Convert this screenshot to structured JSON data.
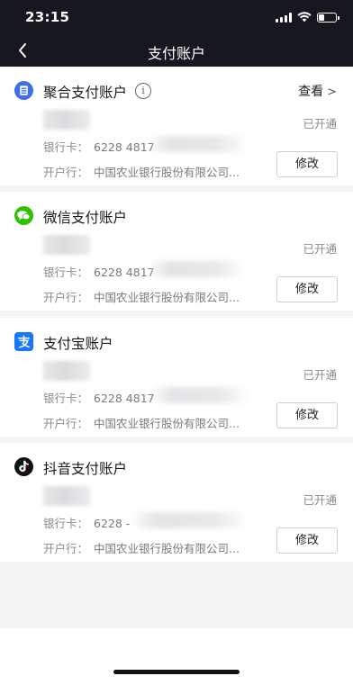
{
  "status_bar": {
    "time": "23:15"
  },
  "nav": {
    "title": "支付账户"
  },
  "labels": {
    "bank_card": "银行卡：",
    "opening_bank": "开户行：",
    "edit": "修改",
    "view": "查看",
    "view_chevron": ">",
    "info_mark": "i"
  },
  "accounts": [
    {
      "name": "聚合支付账户",
      "icon": "aggregate-pay-icon",
      "status": "已开通",
      "card_number": "6228 4817",
      "bank": "中国农业银行股份有限公司...",
      "has_info": true,
      "has_view": true,
      "color": "#3e6ff0"
    },
    {
      "name": "微信支付账户",
      "icon": "wechat-icon",
      "status": "已开通",
      "card_number": "6228 4817",
      "bank": "中国农业银行股份有限公司...",
      "color": "#2dc100"
    },
    {
      "name": "支付宝账户",
      "icon": "alipay-icon",
      "status": "已开通",
      "card_number": "6228 4817",
      "bank": "中国农业银行股份有限公司...",
      "color": "#1677ff"
    },
    {
      "name": "抖音支付账户",
      "icon": "douyin-icon",
      "status": "已开通",
      "card_number": "6228 -",
      "bank": "中国农业银行股份有限公司...",
      "color": "#111111"
    }
  ]
}
